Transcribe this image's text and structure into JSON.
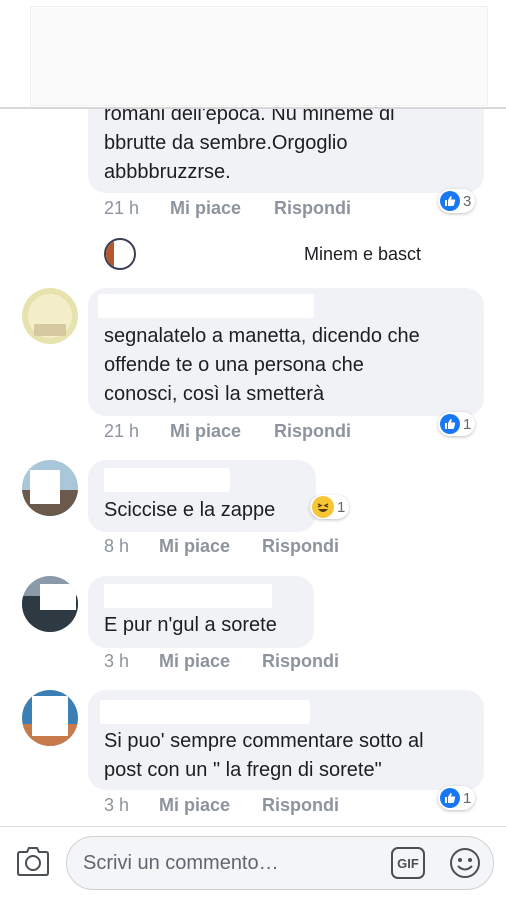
{
  "comments": [
    {
      "lines": [
        "romani dell'epoca. Nu mineme di",
        "bbrutte da sembre.Orgoglio",
        "abbbbruzzrse."
      ],
      "time": "21 h",
      "like_label": "Mi piace",
      "reply_label": "Rispondi",
      "reaction": {
        "type": "like",
        "count": "3"
      }
    },
    {
      "lines": [
        "segnalatelo a manetta, dicendo che",
        "offende te o una persona che",
        "conosci, così la smetterà"
      ],
      "time": "21 h",
      "like_label": "Mi piace",
      "reply_label": "Rispondi",
      "reaction": {
        "type": "like",
        "count": "1"
      }
    },
    {
      "lines": [
        "Sciccise e la zappe"
      ],
      "time": "8 h",
      "like_label": "Mi piace",
      "reply_label": "Rispondi",
      "reaction": {
        "type": "haha",
        "count": "1"
      }
    },
    {
      "lines": [
        "E pur n'gul a sorete"
      ],
      "time": "3 h",
      "like_label": "Mi piace",
      "reply_label": "Rispondi"
    },
    {
      "lines": [
        "Si puo' sempre commentare sotto al",
        "post con un \" la fregn di sorete\""
      ],
      "time": "3 h",
      "like_label": "Mi piace",
      "reply_label": "Rispondi",
      "reaction": {
        "type": "like",
        "count": "1"
      }
    }
  ],
  "reply_preview": {
    "text": "Minem e basct"
  },
  "composer": {
    "placeholder": "Scrivi un commento…",
    "gif_label": "GIF"
  },
  "icons": {
    "camera": "camera-icon",
    "gif": "gif-icon",
    "emoji": "emoji-icon",
    "like": "thumbs-up-icon",
    "haha": "laughing-emoji-icon"
  },
  "colors": {
    "like_blue": "#1877f2",
    "meta_gray": "#8d949e",
    "bubble": "#f1f2f6"
  }
}
